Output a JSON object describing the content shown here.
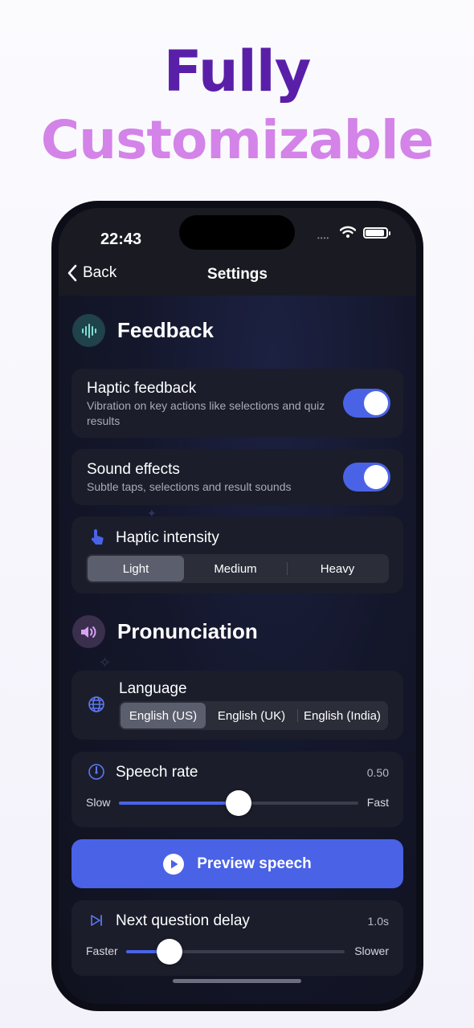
{
  "headline": {
    "line1": "Fully",
    "line2": "Customizable"
  },
  "status_bar": {
    "time": "22:43"
  },
  "nav": {
    "back_label": "Back",
    "title": "Settings"
  },
  "feedback": {
    "section_title": "Feedback",
    "haptic": {
      "title": "Haptic feedback",
      "subtitle": "Vibration on key actions like selections and quiz results",
      "enabled": true
    },
    "sound": {
      "title": "Sound effects",
      "subtitle": "Subtle taps, selections and result sounds",
      "enabled": true
    },
    "intensity": {
      "title": "Haptic intensity",
      "options": [
        "Light",
        "Medium",
        "Heavy"
      ],
      "selected": "Light"
    }
  },
  "pronunciation": {
    "section_title": "Pronunciation",
    "language": {
      "title": "Language",
      "options": [
        "English (US)",
        "English (UK)",
        "English (India)"
      ],
      "selected": "English (US)"
    },
    "speech_rate": {
      "title": "Speech rate",
      "value": "0.50",
      "min_label": "Slow",
      "max_label": "Fast",
      "level": 0.5
    },
    "preview_label": "Preview speech",
    "delay": {
      "title": "Next question delay",
      "value": "1.0s",
      "min_label": "Faster",
      "max_label": "Slower",
      "level": 0.2
    }
  },
  "colors": {
    "accent": "#4a63e6",
    "headline_primary": "#5a1fa8",
    "headline_secondary": "#d483e8"
  }
}
